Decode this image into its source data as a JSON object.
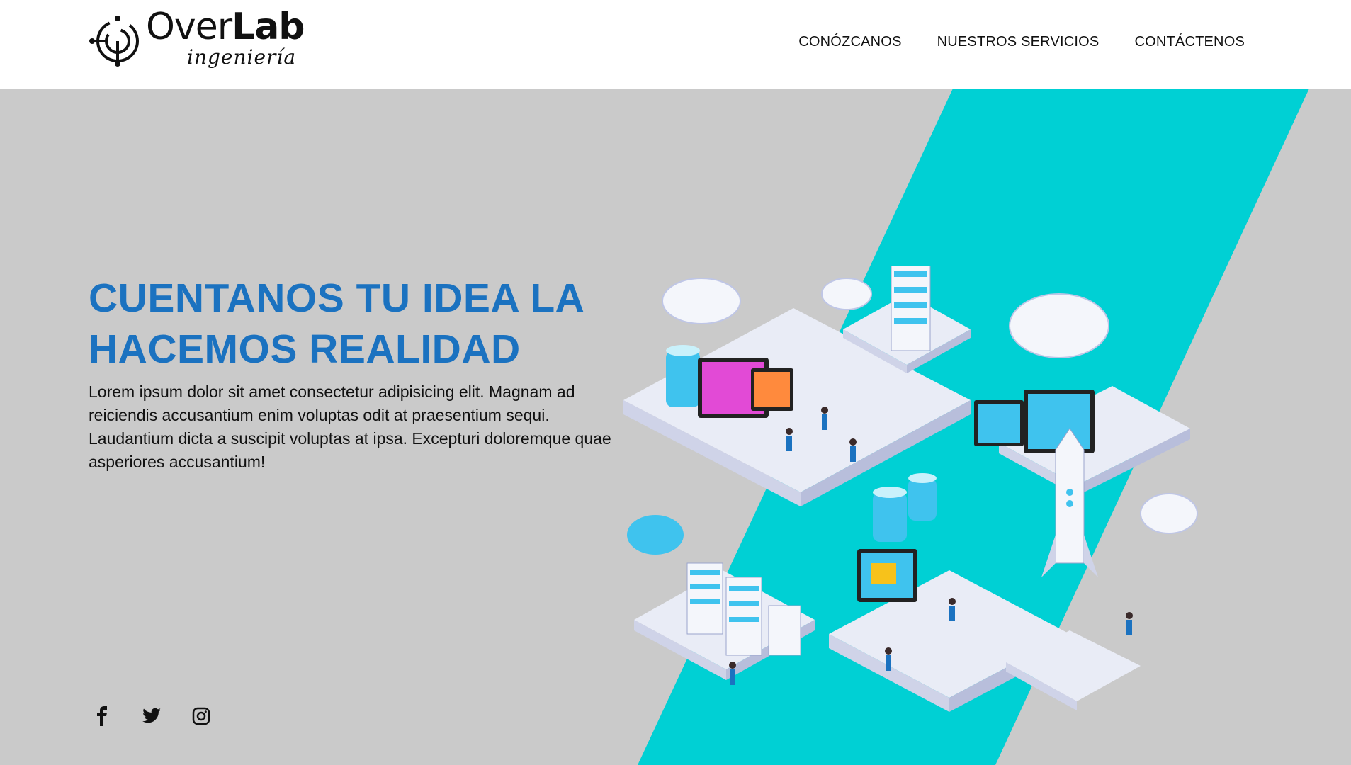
{
  "brand": {
    "name_light": "Over",
    "name_bold": "Lab",
    "subtitle": "ingeniería"
  },
  "nav": {
    "items": [
      {
        "label": "CONÓZCANOS"
      },
      {
        "label": "NUESTROS SERVICIOS"
      },
      {
        "label": "CONTÁCTENOS"
      }
    ]
  },
  "hero": {
    "title_line1": "CUENTANOS TU IDEA LA",
    "title_line2": "HACEMOS REALIDAD",
    "text": "Lorem ipsum dolor sit amet consectetur adipisicing elit. Magnam ad reiciendis accusantium enim voluptas odit at praesentium sequi. Laudantium dicta a suscipit voluptas at ipsa. Excepturi doloremque quae asperiores accusantium!"
  },
  "social": {
    "icons": [
      "facebook-icon",
      "twitter-icon",
      "instagram-icon"
    ]
  },
  "colors": {
    "accent_blue": "#1b72c0",
    "teal": "#00d0d4",
    "hero_bg": "#cacaca",
    "text": "#111111"
  }
}
